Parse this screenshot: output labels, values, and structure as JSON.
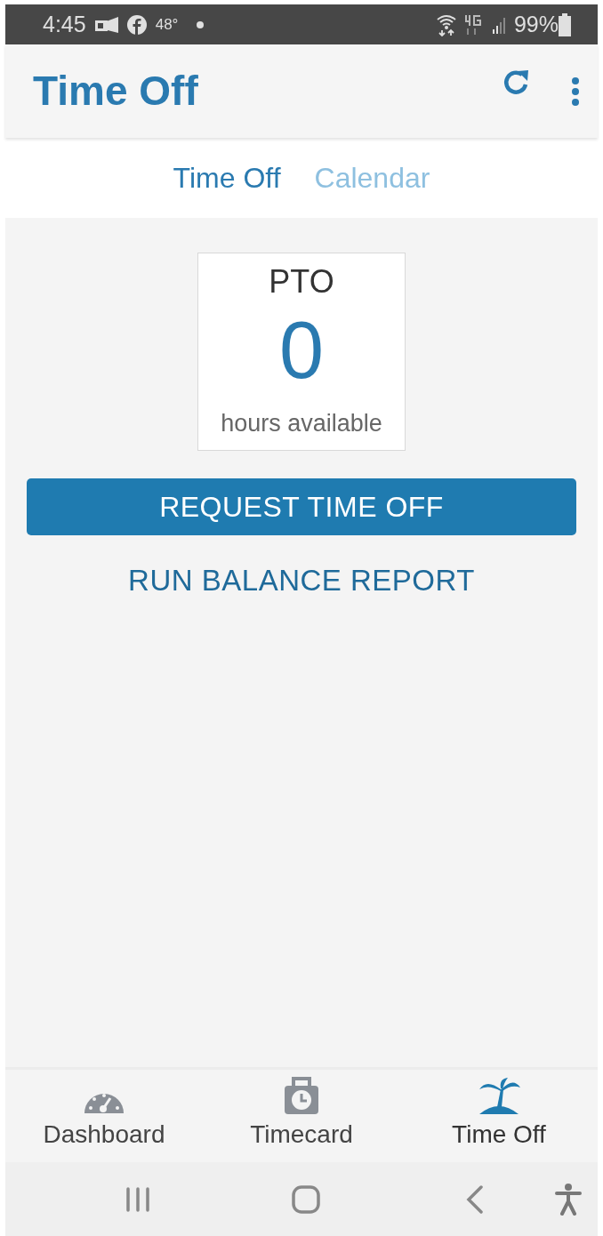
{
  "status_bar": {
    "time": "4:45",
    "temperature": "48°",
    "battery": "99%"
  },
  "app_bar": {
    "title": "Time Off"
  },
  "tabs": [
    {
      "label": "Time Off",
      "selected": true
    },
    {
      "label": "Calendar",
      "selected": false
    }
  ],
  "balance_card": {
    "title": "PTO",
    "value": "0",
    "caption": "hours available"
  },
  "primary_button": "REQUEST TIME OFF",
  "secondary_button": "RUN BALANCE REPORT",
  "bottom_nav": [
    {
      "label": "Dashboard",
      "kind": "gauge",
      "selected": false
    },
    {
      "label": "Timecard",
      "kind": "clock",
      "selected": false
    },
    {
      "label": "Time Off",
      "kind": "palm",
      "selected": true
    }
  ]
}
